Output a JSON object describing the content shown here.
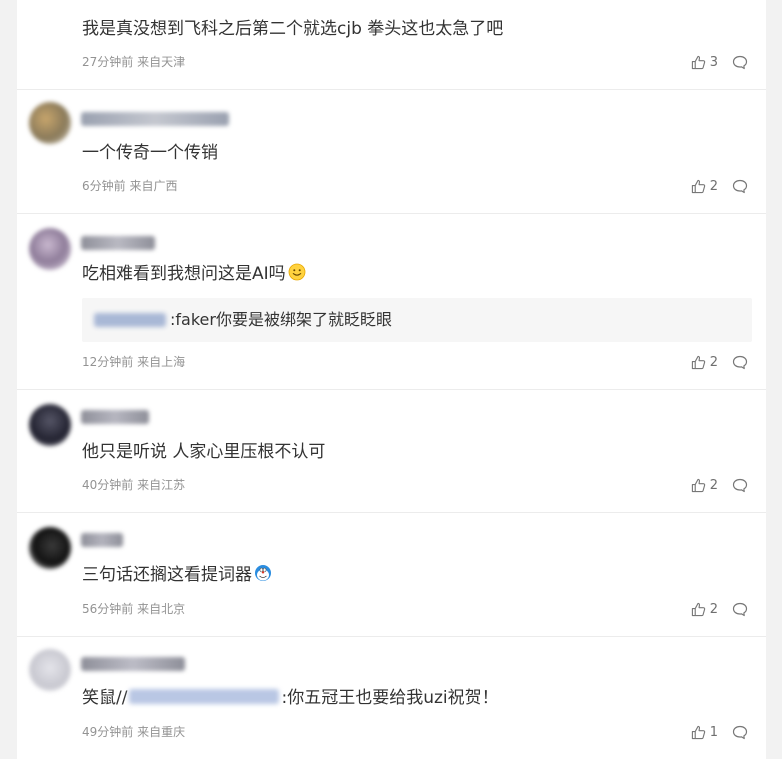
{
  "comments": [
    {
      "text": "我是真没想到飞科之后第二个就选cjb 拳头这也太急了吧",
      "meta": "27分钟前 来自天津",
      "likes": "3",
      "avatar_color": "#d9d9d9"
    },
    {
      "text": "一个传奇一个传销",
      "meta": "6分钟前 来自广西",
      "likes": "2",
      "avatar_color": "#b59a6a"
    },
    {
      "text": "吃相难看到我想问这是AI吗",
      "meta": "12分钟前 来自上海",
      "likes": "2",
      "avatar_color": "#a99bb4",
      "quote_text": ":faker你要是被绑架了就眨眨眼"
    },
    {
      "text": "他只是听说 人家心里压根不认可",
      "meta": "40分钟前 来自江苏",
      "likes": "2",
      "avatar_color": "#3a3a44"
    },
    {
      "text": "三句话还搁这看提词器",
      "meta": "56分钟前 来自北京",
      "likes": "2",
      "avatar_color": "#2b2b2b"
    },
    {
      "text_before": "笑鼠//",
      "text_after": ":你五冠王也要给我uzi祝贺！",
      "meta": "49分钟前 来自重庆",
      "likes": "1",
      "avatar_color": "#d6d6dc"
    }
  ]
}
